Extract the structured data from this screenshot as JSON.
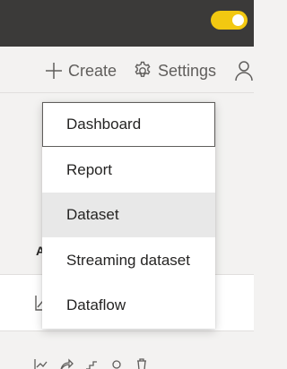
{
  "header": {
    "actions": {
      "create_label": "Create",
      "settings_label": "Settings"
    }
  },
  "create_menu": {
    "items": [
      {
        "label": "Dashboard",
        "state": "focused"
      },
      {
        "label": "Report",
        "state": "normal"
      },
      {
        "label": "Dataset",
        "state": "hovered"
      },
      {
        "label": "Streaming dataset",
        "state": "normal"
      },
      {
        "label": "Dataflow",
        "state": "normal"
      }
    ]
  },
  "background": {
    "column_header_initial": "A"
  },
  "colors": {
    "topbar": "#3b3a39",
    "toggle": "#f2c811",
    "hover": "#e8e8e8"
  }
}
